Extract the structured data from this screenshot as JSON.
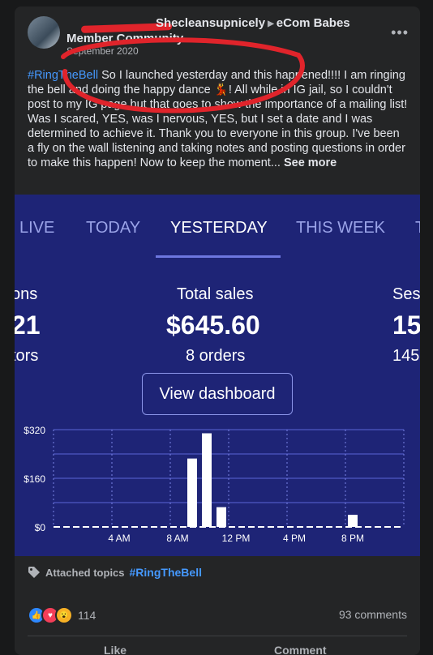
{
  "post": {
    "author": "Shecleansupnicely",
    "group": "eCom Babes Member Community",
    "date": "September 2020",
    "hashtag": "#RingTheBell",
    "body": " So I launched yesterday and this happened!!!! I am ringing the bell and doing the happy dance 💃! All while in IG jail, so I couldn't post to my IG page but that goes to show the importance of a mailing list! Was I scared, YES, was I nervous, YES, but I set a date and I was determined to achieve it. Thank you to everyone in this group. I've been a fly on the wall listening and taking notes  and posting questions in order to make this happen! Now to keep the moment... ",
    "see_more": "See more",
    "more_icon": "more-horizontal-icon"
  },
  "dashboard": {
    "tabs": [
      "LIVE",
      "TODAY",
      "YESTERDAY",
      "THIS WEEK",
      "T"
    ],
    "active_tab": "YESTERDAY",
    "metrics": [
      {
        "label": "ons",
        "value": "21",
        "sub": "tors"
      },
      {
        "label": "Total sales",
        "value": "$645.60",
        "sub": "8 orders"
      },
      {
        "label": "Ses",
        "value": "15",
        "sub": "145"
      }
    ],
    "view_button": "View dashboard"
  },
  "chart_data": {
    "type": "bar",
    "y_ticks": [
      "$320",
      "$160",
      "$0"
    ],
    "x_ticks": [
      "4 AM",
      "8 AM",
      "12 PM",
      "4 PM",
      "8 PM"
    ],
    "ylim": [
      0,
      320
    ],
    "bars": [
      {
        "hour": 9,
        "value": 225
      },
      {
        "hour": 10,
        "value": 308
      },
      {
        "hour": 11,
        "value": 65
      },
      {
        "hour": 20,
        "value": 40
      }
    ],
    "colors": {
      "bar": "#ffffff",
      "grid": "#5a63d6",
      "background": "#1e2476"
    }
  },
  "footer": {
    "attached_label": "Attached topics",
    "topic": "#RingTheBell",
    "reaction_count": "114",
    "comments": "93 comments",
    "like_label": "Like",
    "comment_label": "Comment"
  }
}
